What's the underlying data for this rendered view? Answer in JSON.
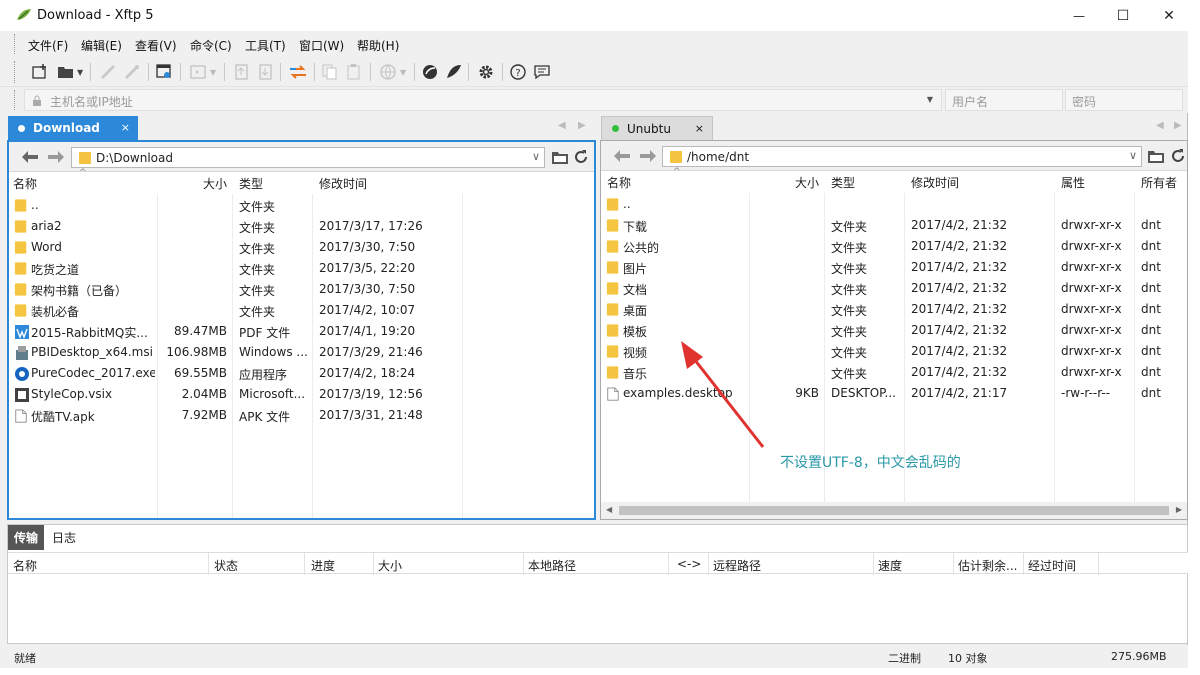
{
  "window": {
    "title": "Download - Xftp 5",
    "controls": {
      "minimize": "—",
      "maximize": "☐",
      "close": "✕"
    }
  },
  "menu": [
    "文件(F)",
    "编辑(E)",
    "查看(V)",
    "命令(C)",
    "工具(T)",
    "窗口(W)",
    "帮助(H)"
  ],
  "toolbar": {
    "icons": [
      "new-session-icon",
      "open-folder-icon",
      "connect-icon",
      "disconnect-icon",
      "properties-icon",
      "terminal-icon",
      "upload-icon",
      "download-icon",
      "sync-icon",
      "copy-icon",
      "paste-icon",
      "globe-icon",
      "xshell-icon",
      "xftp-icon",
      "gear-icon",
      "help-icon",
      "chat-icon"
    ]
  },
  "address": {
    "host_placeholder": "主机名或IP地址",
    "user_placeholder": "用户名",
    "pass_placeholder": "密码"
  },
  "left": {
    "tab": {
      "label": "Download",
      "close": "×"
    },
    "path": "D:\\Download",
    "columns": {
      "name": "名称",
      "size": "大小",
      "type": "类型",
      "mtime": "修改时间"
    },
    "rows": [
      {
        "icon": "folder-up",
        "name": "..",
        "size": "",
        "type": "文件夹",
        "mtime": ""
      },
      {
        "icon": "folder",
        "name": "aria2",
        "size": "",
        "type": "文件夹",
        "mtime": "2017/3/17, 17:26"
      },
      {
        "icon": "folder",
        "name": "Word",
        "size": "",
        "type": "文件夹",
        "mtime": "2017/3/30, 7:50"
      },
      {
        "icon": "folder",
        "name": "吃货之道",
        "size": "",
        "type": "文件夹",
        "mtime": "2017/3/5, 22:20"
      },
      {
        "icon": "folder",
        "name": "架构书籍（已备）",
        "size": "",
        "type": "文件夹",
        "mtime": "2017/3/30, 7:50"
      },
      {
        "icon": "folder",
        "name": "装机必备",
        "size": "",
        "type": "文件夹",
        "mtime": "2017/4/2, 10:07"
      },
      {
        "icon": "pdf",
        "name": "2015-RabbitMQ实...",
        "size": "89.47MB",
        "type": "PDF 文件",
        "mtime": "2017/4/1, 19:20"
      },
      {
        "icon": "msi",
        "name": "PBIDesktop_x64.msi",
        "size": "106.98MB",
        "type": "Windows ...",
        "mtime": "2017/3/29, 21:46"
      },
      {
        "icon": "exe",
        "name": "PureCodec_2017.exe",
        "size": "69.55MB",
        "type": "应用程序",
        "mtime": "2017/4/2, 18:24"
      },
      {
        "icon": "vsix",
        "name": "StyleCop.vsix",
        "size": "2.04MB",
        "type": "Microsoft...",
        "mtime": "2017/3/19, 12:56"
      },
      {
        "icon": "file",
        "name": "优酷TV.apk",
        "size": "7.92MB",
        "type": "APK 文件",
        "mtime": "2017/3/31, 21:48"
      }
    ]
  },
  "right": {
    "tab": {
      "label": "Unubtu",
      "close": "×"
    },
    "path": "/home/dnt",
    "columns": {
      "name": "名称",
      "size": "大小",
      "type": "类型",
      "mtime": "修改时间",
      "attr": "属性",
      "owner": "所有者"
    },
    "rows": [
      {
        "icon": "folder-up",
        "name": "..",
        "size": "",
        "type": "",
        "mtime": "",
        "attr": "",
        "owner": ""
      },
      {
        "icon": "folder",
        "name": "下载",
        "size": "",
        "type": "文件夹",
        "mtime": "2017/4/2, 21:32",
        "attr": "drwxr-xr-x",
        "owner": "dnt"
      },
      {
        "icon": "folder",
        "name": "公共的",
        "size": "",
        "type": "文件夹",
        "mtime": "2017/4/2, 21:32",
        "attr": "drwxr-xr-x",
        "owner": "dnt"
      },
      {
        "icon": "folder",
        "name": "图片",
        "size": "",
        "type": "文件夹",
        "mtime": "2017/4/2, 21:32",
        "attr": "drwxr-xr-x",
        "owner": "dnt"
      },
      {
        "icon": "folder",
        "name": "文档",
        "size": "",
        "type": "文件夹",
        "mtime": "2017/4/2, 21:32",
        "attr": "drwxr-xr-x",
        "owner": "dnt"
      },
      {
        "icon": "folder",
        "name": "桌面",
        "size": "",
        "type": "文件夹",
        "mtime": "2017/4/2, 21:32",
        "attr": "drwxr-xr-x",
        "owner": "dnt"
      },
      {
        "icon": "folder",
        "name": "模板",
        "size": "",
        "type": "文件夹",
        "mtime": "2017/4/2, 21:32",
        "attr": "drwxr-xr-x",
        "owner": "dnt"
      },
      {
        "icon": "folder",
        "name": "视频",
        "size": "",
        "type": "文件夹",
        "mtime": "2017/4/2, 21:32",
        "attr": "drwxr-xr-x",
        "owner": "dnt"
      },
      {
        "icon": "folder",
        "name": "音乐",
        "size": "",
        "type": "文件夹",
        "mtime": "2017/4/2, 21:32",
        "attr": "drwxr-xr-x",
        "owner": "dnt"
      },
      {
        "icon": "file",
        "name": "examples.desktop",
        "size": "9KB",
        "type": "DESKTOP...",
        "mtime": "2017/4/2, 21:17",
        "attr": "-rw-r--r--",
        "owner": "dnt"
      }
    ]
  },
  "annotation": "不设置UTF-8，中文会乱码的",
  "bottom": {
    "tabs": [
      "传输",
      "日志"
    ],
    "columns": [
      "名称",
      "状态",
      "进度",
      "大小",
      "本地路径",
      "<->",
      "远程路径",
      "速度",
      "估计剩余...",
      "经过时间"
    ]
  },
  "status": {
    "ready": "就绪",
    "mode": "二进制",
    "objects": "10 对象",
    "size": "275.96MB"
  },
  "colors": {
    "accent": "#2c89d9",
    "folder": "#f5c542",
    "annotation": "#2a98a8",
    "arrow": "#e0322f",
    "online_dot": "#2fbf3a"
  }
}
